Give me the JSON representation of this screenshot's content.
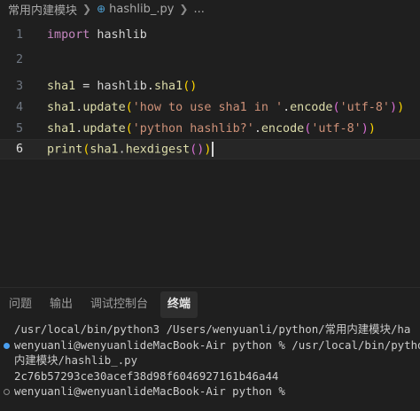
{
  "breadcrumb": {
    "folder": "常用内建模块",
    "file": "hashlib_.py",
    "more": "..."
  },
  "editor": {
    "lines": [
      {
        "num": "1",
        "tokens": [
          {
            "t": "import",
            "c": "kw"
          },
          {
            "t": " hashlib",
            "c": "plain"
          }
        ]
      },
      {
        "num": "2",
        "tokens": []
      },
      {
        "num": "3",
        "tokens": [
          {
            "t": "sha1",
            "c": "fn"
          },
          {
            "t": " = hashlib.",
            "c": "plain"
          },
          {
            "t": "sha1",
            "c": "fn"
          },
          {
            "t": "()",
            "c": "br1"
          }
        ]
      },
      {
        "num": "4",
        "tokens": [
          {
            "t": "sha1",
            "c": "fn"
          },
          {
            "t": ".",
            "c": "plain"
          },
          {
            "t": "update",
            "c": "fn"
          },
          {
            "t": "(",
            "c": "br1"
          },
          {
            "t": "'how to use sha1 in '",
            "c": "str"
          },
          {
            "t": ".",
            "c": "plain"
          },
          {
            "t": "encode",
            "c": "fn"
          },
          {
            "t": "(",
            "c": "br2"
          },
          {
            "t": "'utf-8'",
            "c": "str"
          },
          {
            "t": ")",
            "c": "br2"
          },
          {
            "t": ")",
            "c": "br1"
          }
        ]
      },
      {
        "num": "5",
        "tokens": [
          {
            "t": "sha1",
            "c": "fn"
          },
          {
            "t": ".",
            "c": "plain"
          },
          {
            "t": "update",
            "c": "fn"
          },
          {
            "t": "(",
            "c": "br1"
          },
          {
            "t": "'python hashlib?'",
            "c": "str"
          },
          {
            "t": ".",
            "c": "plain"
          },
          {
            "t": "encode",
            "c": "fn"
          },
          {
            "t": "(",
            "c": "br2"
          },
          {
            "t": "'utf-8'",
            "c": "str"
          },
          {
            "t": ")",
            "c": "br2"
          },
          {
            "t": ")",
            "c": "br1"
          }
        ]
      },
      {
        "num": "6",
        "active": true,
        "tokens": [
          {
            "t": "print",
            "c": "fn"
          },
          {
            "t": "(",
            "c": "br1"
          },
          {
            "t": "sha1",
            "c": "fn"
          },
          {
            "t": ".",
            "c": "plain"
          },
          {
            "t": "hexdigest",
            "c": "fn"
          },
          {
            "t": "()",
            "c": "br2"
          },
          {
            "t": ")",
            "c": "br1"
          }
        ]
      }
    ]
  },
  "panel": {
    "tabs": [
      {
        "label": "问题",
        "active": false
      },
      {
        "label": "输出",
        "active": false
      },
      {
        "label": "调试控制台",
        "active": false
      },
      {
        "label": "终端",
        "active": true
      }
    ],
    "terminal": [
      {
        "text": "/usr/local/bin/python3 /Users/wenyuanli/python/常用内建模块/ha",
        "dot": "none"
      },
      {
        "text": "wenyuanli@wenyuanlideMacBook-Air python % /usr/local/bin/pytho",
        "dot": "filled"
      },
      {
        "text": "内建模块/hashlib_.py",
        "dot": "none"
      },
      {
        "text": "2c76b57293ce30acef38d98f6046927161b46a44",
        "dot": "none"
      },
      {
        "text": "wenyuanli@wenyuanlideMacBook-Air python %",
        "dot": "hollow"
      }
    ]
  }
}
